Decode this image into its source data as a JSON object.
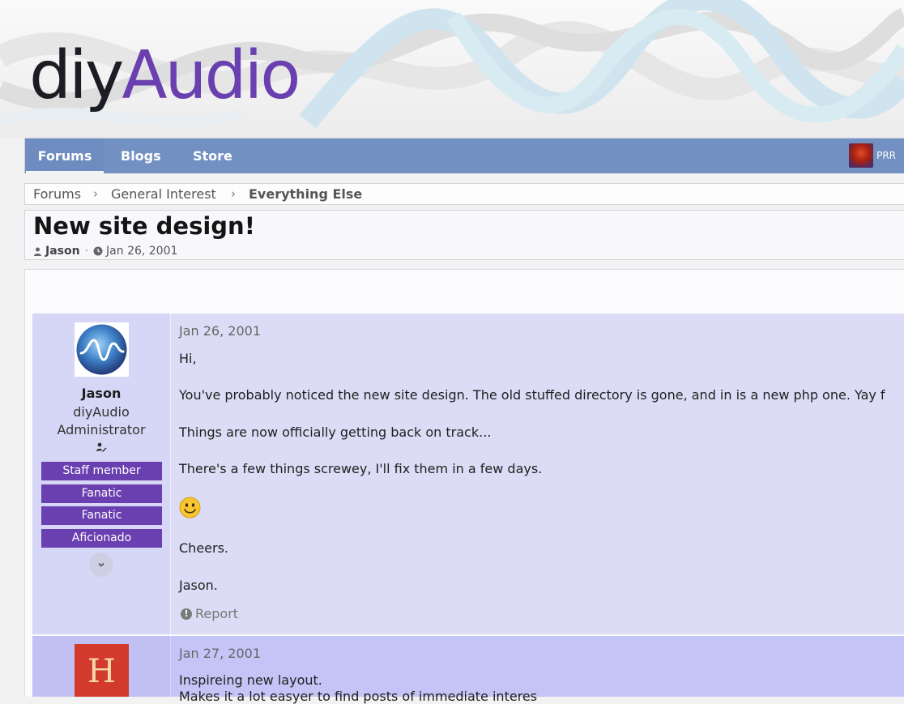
{
  "logo": {
    "part1": "diy",
    "part2": "Audio"
  },
  "nav": {
    "tabs": [
      "Forums",
      "Blogs",
      "Store"
    ],
    "user": "PRR"
  },
  "breadcrumb": [
    "Forums",
    "General Interest",
    "Everything Else"
  ],
  "thread": {
    "title": "New site design!",
    "author": "Jason",
    "date": "Jan 26, 2001"
  },
  "posts": [
    {
      "date": "Jan 26, 2001",
      "user": {
        "name": "Jason",
        "title_line1": "diyAudio",
        "title_line2": "Administrator",
        "badges": [
          "Staff member",
          "Fanatic",
          "Fanatic",
          "Aficionado"
        ]
      },
      "lines": [
        "Hi,",
        "You've probably noticed the new site design. The old stuffed directory is gone, and in is a new php one. Yay f",
        "Things are now officially getting back on track...",
        "There's a few things screwey, I'll fix them in a few days.",
        "Cheers.",
        "Jason."
      ],
      "smiley": "smiley-icon",
      "report": "Report"
    },
    {
      "date": "Jan 27, 2001",
      "avatar_letter": "H",
      "lines": [
        "Inspireing new layout.",
        "Makes it a lot easyer to find posts of immediate interes"
      ]
    }
  ],
  "colors": {
    "brand_purple": "#6a3fb0",
    "nav_blue": "#7390c2",
    "post_bg": "#dcdcf6",
    "post2_bg": "#c4c4f6"
  }
}
